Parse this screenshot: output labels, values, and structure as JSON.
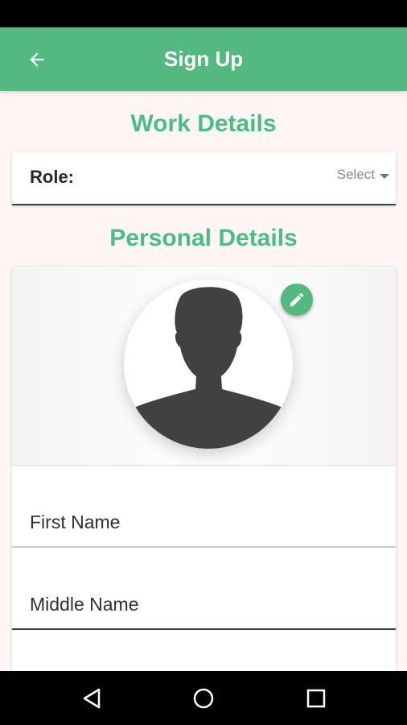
{
  "header": {
    "title": "Sign Up"
  },
  "work_details": {
    "title": "Work Details",
    "role_label": "Role:",
    "role_select_value": "Select"
  },
  "personal_details": {
    "title": "Personal Details",
    "fields": [
      {
        "label": "First Name"
      },
      {
        "label": "Middle Name"
      },
      {
        "label": ""
      }
    ]
  },
  "icons": {
    "back": "arrow-left-icon",
    "edit": "pencil-icon",
    "nav_back": "triangle-back-icon",
    "nav_home": "circle-home-icon",
    "nav_recents": "square-recents-icon"
  },
  "colors": {
    "primary": "#54b981",
    "section_title": "#4dbb84",
    "background": "#fdf6f4"
  }
}
